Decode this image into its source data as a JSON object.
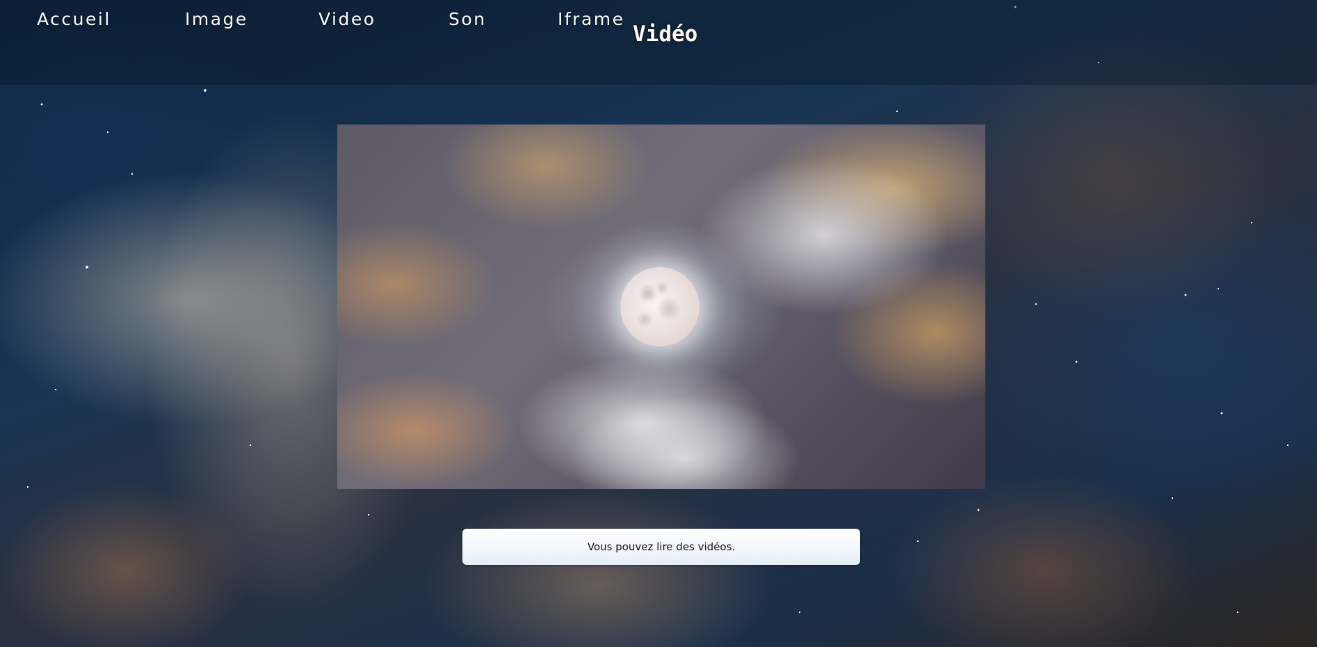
{
  "nav": {
    "items": [
      {
        "label": "Accueil"
      },
      {
        "label": "Image"
      },
      {
        "label": "Video"
      },
      {
        "label": "Son"
      },
      {
        "label": "Iframe"
      }
    ]
  },
  "page": {
    "title": "Vidéo"
  },
  "video": {
    "thumbnail_subject": "full moon among clouds"
  },
  "caption": {
    "text": "Vous pouvez lire des vidéos."
  },
  "colors": {
    "nav_text": "#ffffff",
    "caption_background": "#f2f6fb",
    "caption_text": "#111111"
  }
}
